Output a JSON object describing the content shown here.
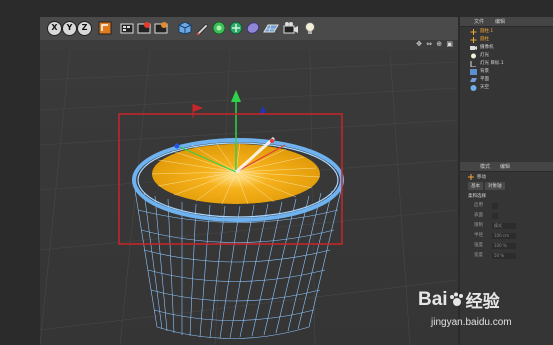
{
  "toolbar": {
    "axis_buttons": [
      "X",
      "Y",
      "Z"
    ],
    "tools": [
      "coordinate-system-icon",
      "render-view-icon",
      "render-icon",
      "render-settings-icon",
      "cube-icon",
      "pen-icon",
      "subdivision-icon",
      "cloner-icon",
      "deformer-icon",
      "floor-icon",
      "camera-icon",
      "light-icon"
    ]
  },
  "viewport": {
    "nav_glyphs": "✥ ⇔ ⊕ ▣"
  },
  "object_manager": {
    "tabs": [
      "文件",
      "编辑"
    ],
    "objects": [
      {
        "label": "圆柱.1",
        "icon": "null-icon",
        "selected": true
      },
      {
        "label": "圆柱",
        "icon": "null-icon",
        "selected": true
      },
      {
        "label": "摄像机",
        "icon": "camera-icon",
        "selected": false
      },
      {
        "label": "灯光",
        "icon": "light-icon",
        "selected": false
      },
      {
        "label": "灯光 目标.1",
        "icon": "target-light-icon",
        "selected": false
      },
      {
        "label": "背景",
        "icon": "background-icon",
        "selected": false
      },
      {
        "label": "平面",
        "icon": "plane-icon",
        "selected": false
      },
      {
        "label": "天空",
        "icon": "sky-icon",
        "selected": false
      }
    ]
  },
  "attributes": {
    "tabs": [
      "模式",
      "编辑"
    ],
    "mode": "移动",
    "subtabs": [
      "基本",
      "对象轴"
    ],
    "section": "柔和选择",
    "rows": [
      {
        "label": "启用",
        "value": ""
      },
      {
        "label": "表面",
        "value": ""
      },
      {
        "label": "限制",
        "value": "模式"
      },
      {
        "label": "半径",
        "value": "100 cm"
      },
      {
        "label": "强度",
        "value": "100 %"
      },
      {
        "label": "宽度",
        "value": "50 %"
      }
    ]
  },
  "colors": {
    "fill_orange": "#f2a70e",
    "wire_blue": "#8ec6ff",
    "selection_red": "#c8262a",
    "axis_green": "#2fd24a"
  },
  "watermark": {
    "brand": "Bai",
    "brand2": "经验",
    "url": "jingyan.baidu.com"
  }
}
